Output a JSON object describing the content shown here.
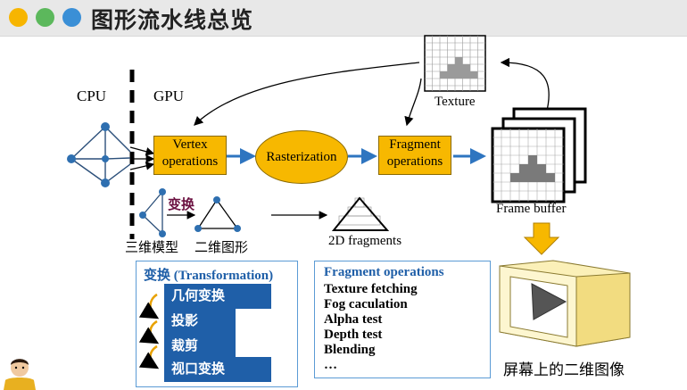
{
  "header": {
    "title": "图形流水线总览",
    "dots": [
      "#f7b500",
      "#5cb85c",
      "#3a8fd6"
    ]
  },
  "labels": {
    "cpu": "CPU",
    "gpu": "GPU",
    "texture": "Texture",
    "frame_buffer": "Frame buffer",
    "fragments_2d": "2D fragments",
    "transform_small": "变换",
    "model_3d": "三维模型",
    "shape_2d": "二维图形",
    "screen_image": "屏幕上的二维图像"
  },
  "pipeline": {
    "vertex": [
      "Vertex",
      "operations"
    ],
    "raster": "Rasterization",
    "fragment": [
      "Fragment",
      "operations"
    ]
  },
  "transform_panel": {
    "title_cn": "变换",
    "title_en": "(Transformation)",
    "steps": [
      "几何变换",
      "投影",
      "裁剪",
      "视口变换"
    ]
  },
  "fragment_panel": {
    "title": "Fragment operations",
    "items": [
      "Texture fetching",
      "Fog caculation",
      "Alpha test",
      "Depth test",
      "Blending",
      "…"
    ]
  }
}
